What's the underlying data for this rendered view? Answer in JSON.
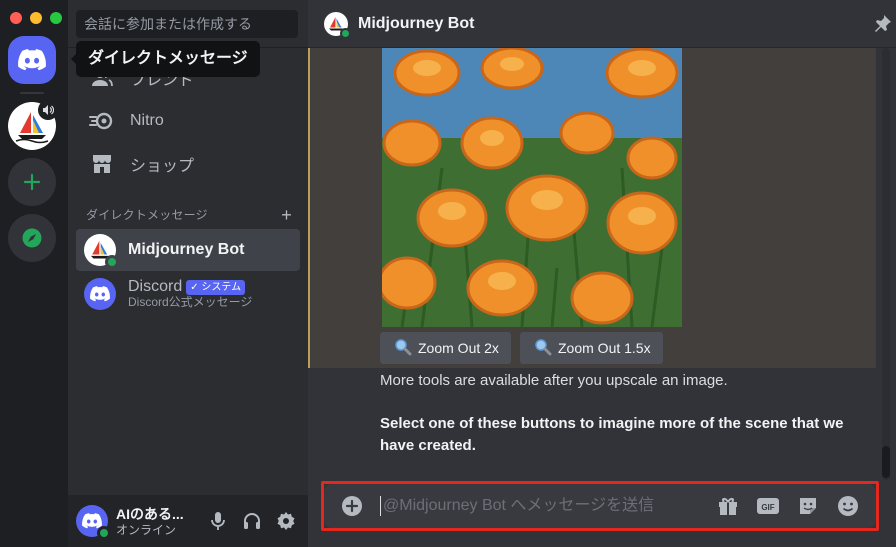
{
  "window": {
    "tooltip": "ダイレクトメッセージ"
  },
  "sidebar": {
    "search_placeholder": "会話に参加または作成する",
    "nav": [
      {
        "label": "フレンド",
        "icon": "friends-icon"
      },
      {
        "label": "Nitro",
        "icon": "nitro-icon"
      },
      {
        "label": "ショップ",
        "icon": "shop-icon"
      }
    ],
    "dm_header": "ダイレクトメッセージ",
    "dms": [
      {
        "name": "Midjourney Bot",
        "status": "online",
        "selected": true
      },
      {
        "name": "Discord",
        "badge": "✓ システム",
        "subtitle": "Discord公式メッセージ"
      }
    ]
  },
  "user": {
    "name": "AIのある...",
    "status": "オンライン"
  },
  "channel": {
    "title": "Midjourney Bot"
  },
  "message": {
    "buttons": [
      {
        "label": "Zoom Out 2x",
        "icon": "magnifier-icon"
      },
      {
        "label": "Zoom Out 1.5x",
        "icon": "magnifier-icon"
      }
    ],
    "text1": "More tools are available after you upscale an image.",
    "text2": "Select one of these buttons to imagine more of the scene that we have created."
  },
  "composer": {
    "placeholder": "@Midjourney Bot へメッセージを送信",
    "icons": [
      "gift-icon",
      "gif-icon",
      "sticker-icon",
      "emoji-icon"
    ]
  },
  "colors": {
    "blurple": "#5865f2",
    "online": "#23a55a",
    "highlight": "#e5281f",
    "accent_bar": "#b8a05a"
  }
}
